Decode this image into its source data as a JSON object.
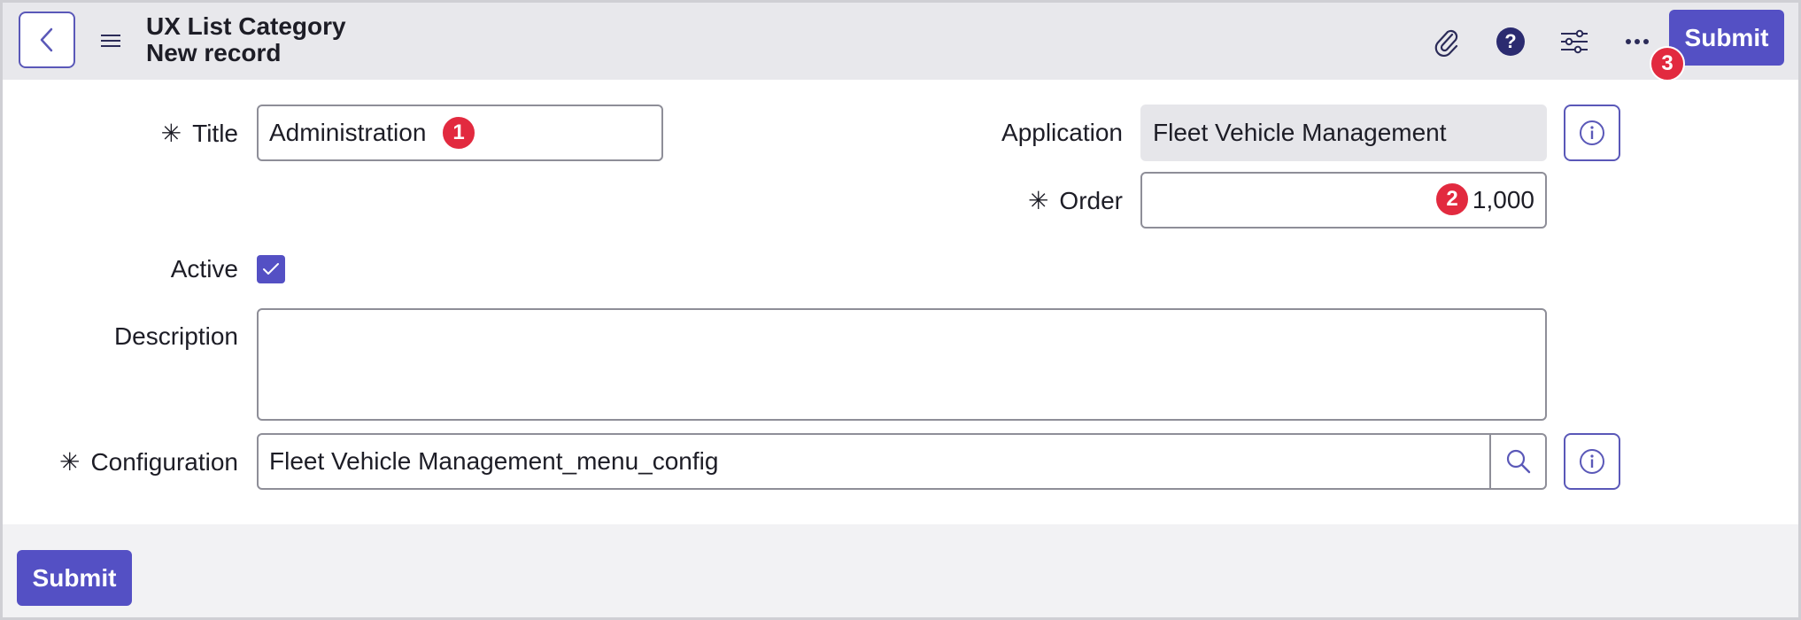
{
  "header": {
    "title": "UX List Category",
    "subtitle": "New record",
    "submit_label": "Submit",
    "icons": [
      "back-icon",
      "hamburger-menu-icon",
      "paperclip-icon",
      "help-icon",
      "settings-sliders-icon",
      "more-icon"
    ]
  },
  "form": {
    "title": {
      "label": "Title",
      "required_mark": "✳",
      "value": "Administration"
    },
    "application": {
      "label": "Application",
      "value": "Fleet Vehicle Management"
    },
    "order": {
      "label": "Order",
      "required_mark": "✳",
      "value": "1,000"
    },
    "active": {
      "label": "Active",
      "checked": true
    },
    "description": {
      "label": "Description",
      "value": ""
    },
    "configuration": {
      "label": "Configuration",
      "required_mark": "✳",
      "value": "Fleet Vehicle Management_menu_config"
    }
  },
  "badges": {
    "one": "1",
    "two": "2",
    "three": "3"
  },
  "footer": {
    "submit_label": "Submit"
  },
  "colors": {
    "primary": "#5450c4",
    "badge": "#e22a3f",
    "header_bg": "#e8e8ec"
  }
}
